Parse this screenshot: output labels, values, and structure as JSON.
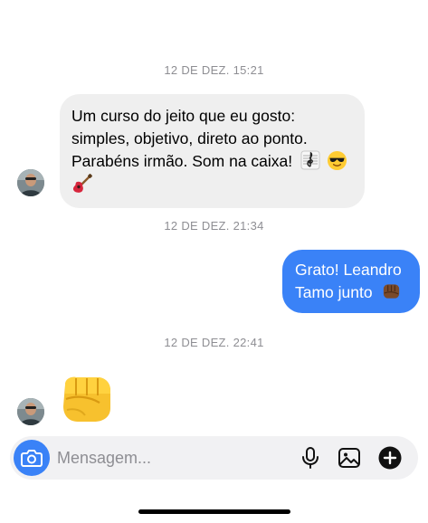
{
  "thread": {
    "timestamps": [
      "12 DE DEZ. 15:21",
      "12 DE DEZ. 21:34",
      "12 DE DEZ. 22:41"
    ],
    "messages": [
      {
        "direction": "incoming",
        "lines": [
          "Um curso do jeito que eu gosto:",
          "simples, objetivo, direto ao ponto.",
          "Parabéns irmão. Som na caixa!",
          ""
        ],
        "emojis": [
          "treble-clef",
          "smiling-face-with-sunglasses",
          "guitar"
        ]
      },
      {
        "direction": "outgoing",
        "lines": [
          "Grato! Leandro",
          "Tamo junto"
        ],
        "emojis": [
          "oncoming-fist-dark-skin-tone"
        ],
        "bubble_color": "#3a82f7"
      },
      {
        "direction": "incoming",
        "lines": [],
        "emojis": [
          "oncoming-fist-yellow"
        ]
      }
    ]
  },
  "composer": {
    "placeholder": "Mensagem...",
    "camera_color": "#3a82f7",
    "icons": [
      "camera-icon",
      "microphone-icon",
      "gallery-icon",
      "add-circle-icon"
    ]
  },
  "colors": {
    "incoming_bubble": "#efefef",
    "outgoing_bubble": "#3a82f7",
    "timestamp": "#8e8e93"
  }
}
